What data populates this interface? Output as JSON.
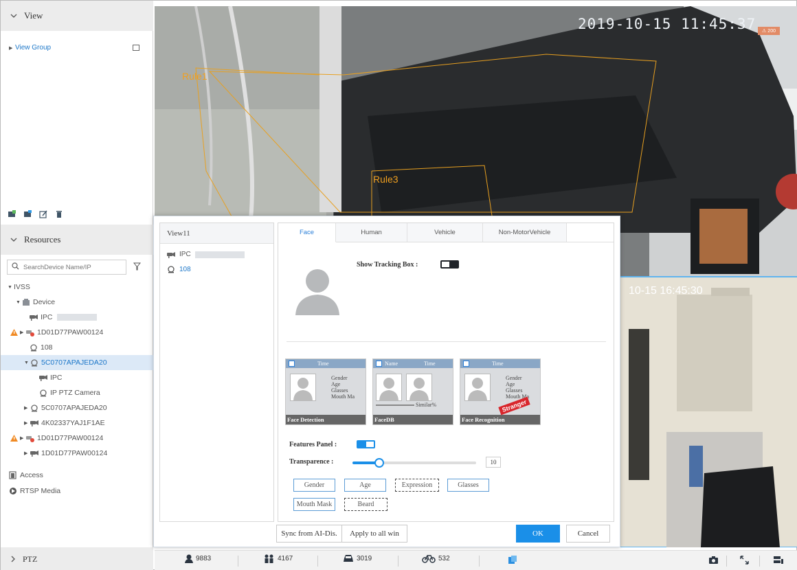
{
  "view_panel": {
    "title": "View",
    "group_label": "View Group"
  },
  "resources": {
    "title": "Resources",
    "search_placeholder": "SearchDevice Name/IP",
    "tree": [
      {
        "label": "IVSS"
      },
      {
        "label": "Device"
      },
      {
        "label": "IPC"
      },
      {
        "label": "1D01D77PAW00124"
      },
      {
        "label": "108"
      },
      {
        "label": "5C0707APAJEDA20"
      },
      {
        "label": "IPC"
      },
      {
        "label": "IP PTZ Camera"
      },
      {
        "label": "5C0707APAJEDA20"
      },
      {
        "label": "4K02337YAJ1F1AE"
      },
      {
        "label": "1D01D77PAW00124"
      },
      {
        "label": "1D01D77PAW00124"
      },
      {
        "label": "Access"
      },
      {
        "label": "RTSP Media"
      }
    ]
  },
  "ptz": {
    "label": "PTZ"
  },
  "video": {
    "timestamp": "2019-10-15 11:45:37",
    "rule1": "Rule1",
    "rule3": "Rule3",
    "alarm_badge": "200",
    "pip_timestamp": "10-15 16:45:30"
  },
  "dialog": {
    "view_title": "View11",
    "view_items": [
      "IPC",
      "108"
    ],
    "tabs": [
      "Face",
      "Human",
      "Vehicle",
      "Non-MotorVehicle"
    ],
    "show_tracking_label": "Show Tracking Box :",
    "cards": [
      {
        "header": "Time",
        "footer": "Face Detection",
        "attrs": [
          "Gender",
          "Age",
          "Glasses",
          "Mouth Ma"
        ]
      },
      {
        "header_left": "Name",
        "header": "Time",
        "footer": "FaceDB",
        "similar": "Similar%"
      },
      {
        "header": "Time",
        "footer": "Face Recognition",
        "attrs": [
          "Gender",
          "Age",
          "Glasses",
          "Mouth Ma"
        ],
        "stamp": "Stranger"
      }
    ],
    "features_panel_label": "Features Panel :",
    "transparence_label": "Transparence :",
    "transparence_value": "10",
    "transparence_fraction": 0.1,
    "features": [
      "Gender",
      "Age",
      "Expression",
      "Glasses",
      "Mouth Mask",
      "Beard"
    ],
    "sync_label": "Sync from AI-Dis.",
    "apply_label": "Apply to all win",
    "ok_label": "OK",
    "cancel_label": "Cancel"
  },
  "counts": {
    "face": "9883",
    "human": "4167",
    "vehicle": "3019",
    "bike": "532"
  },
  "colors": {
    "accent": "#1a8fe8",
    "rule": "#e8a020",
    "alarm": "#e0541a"
  }
}
